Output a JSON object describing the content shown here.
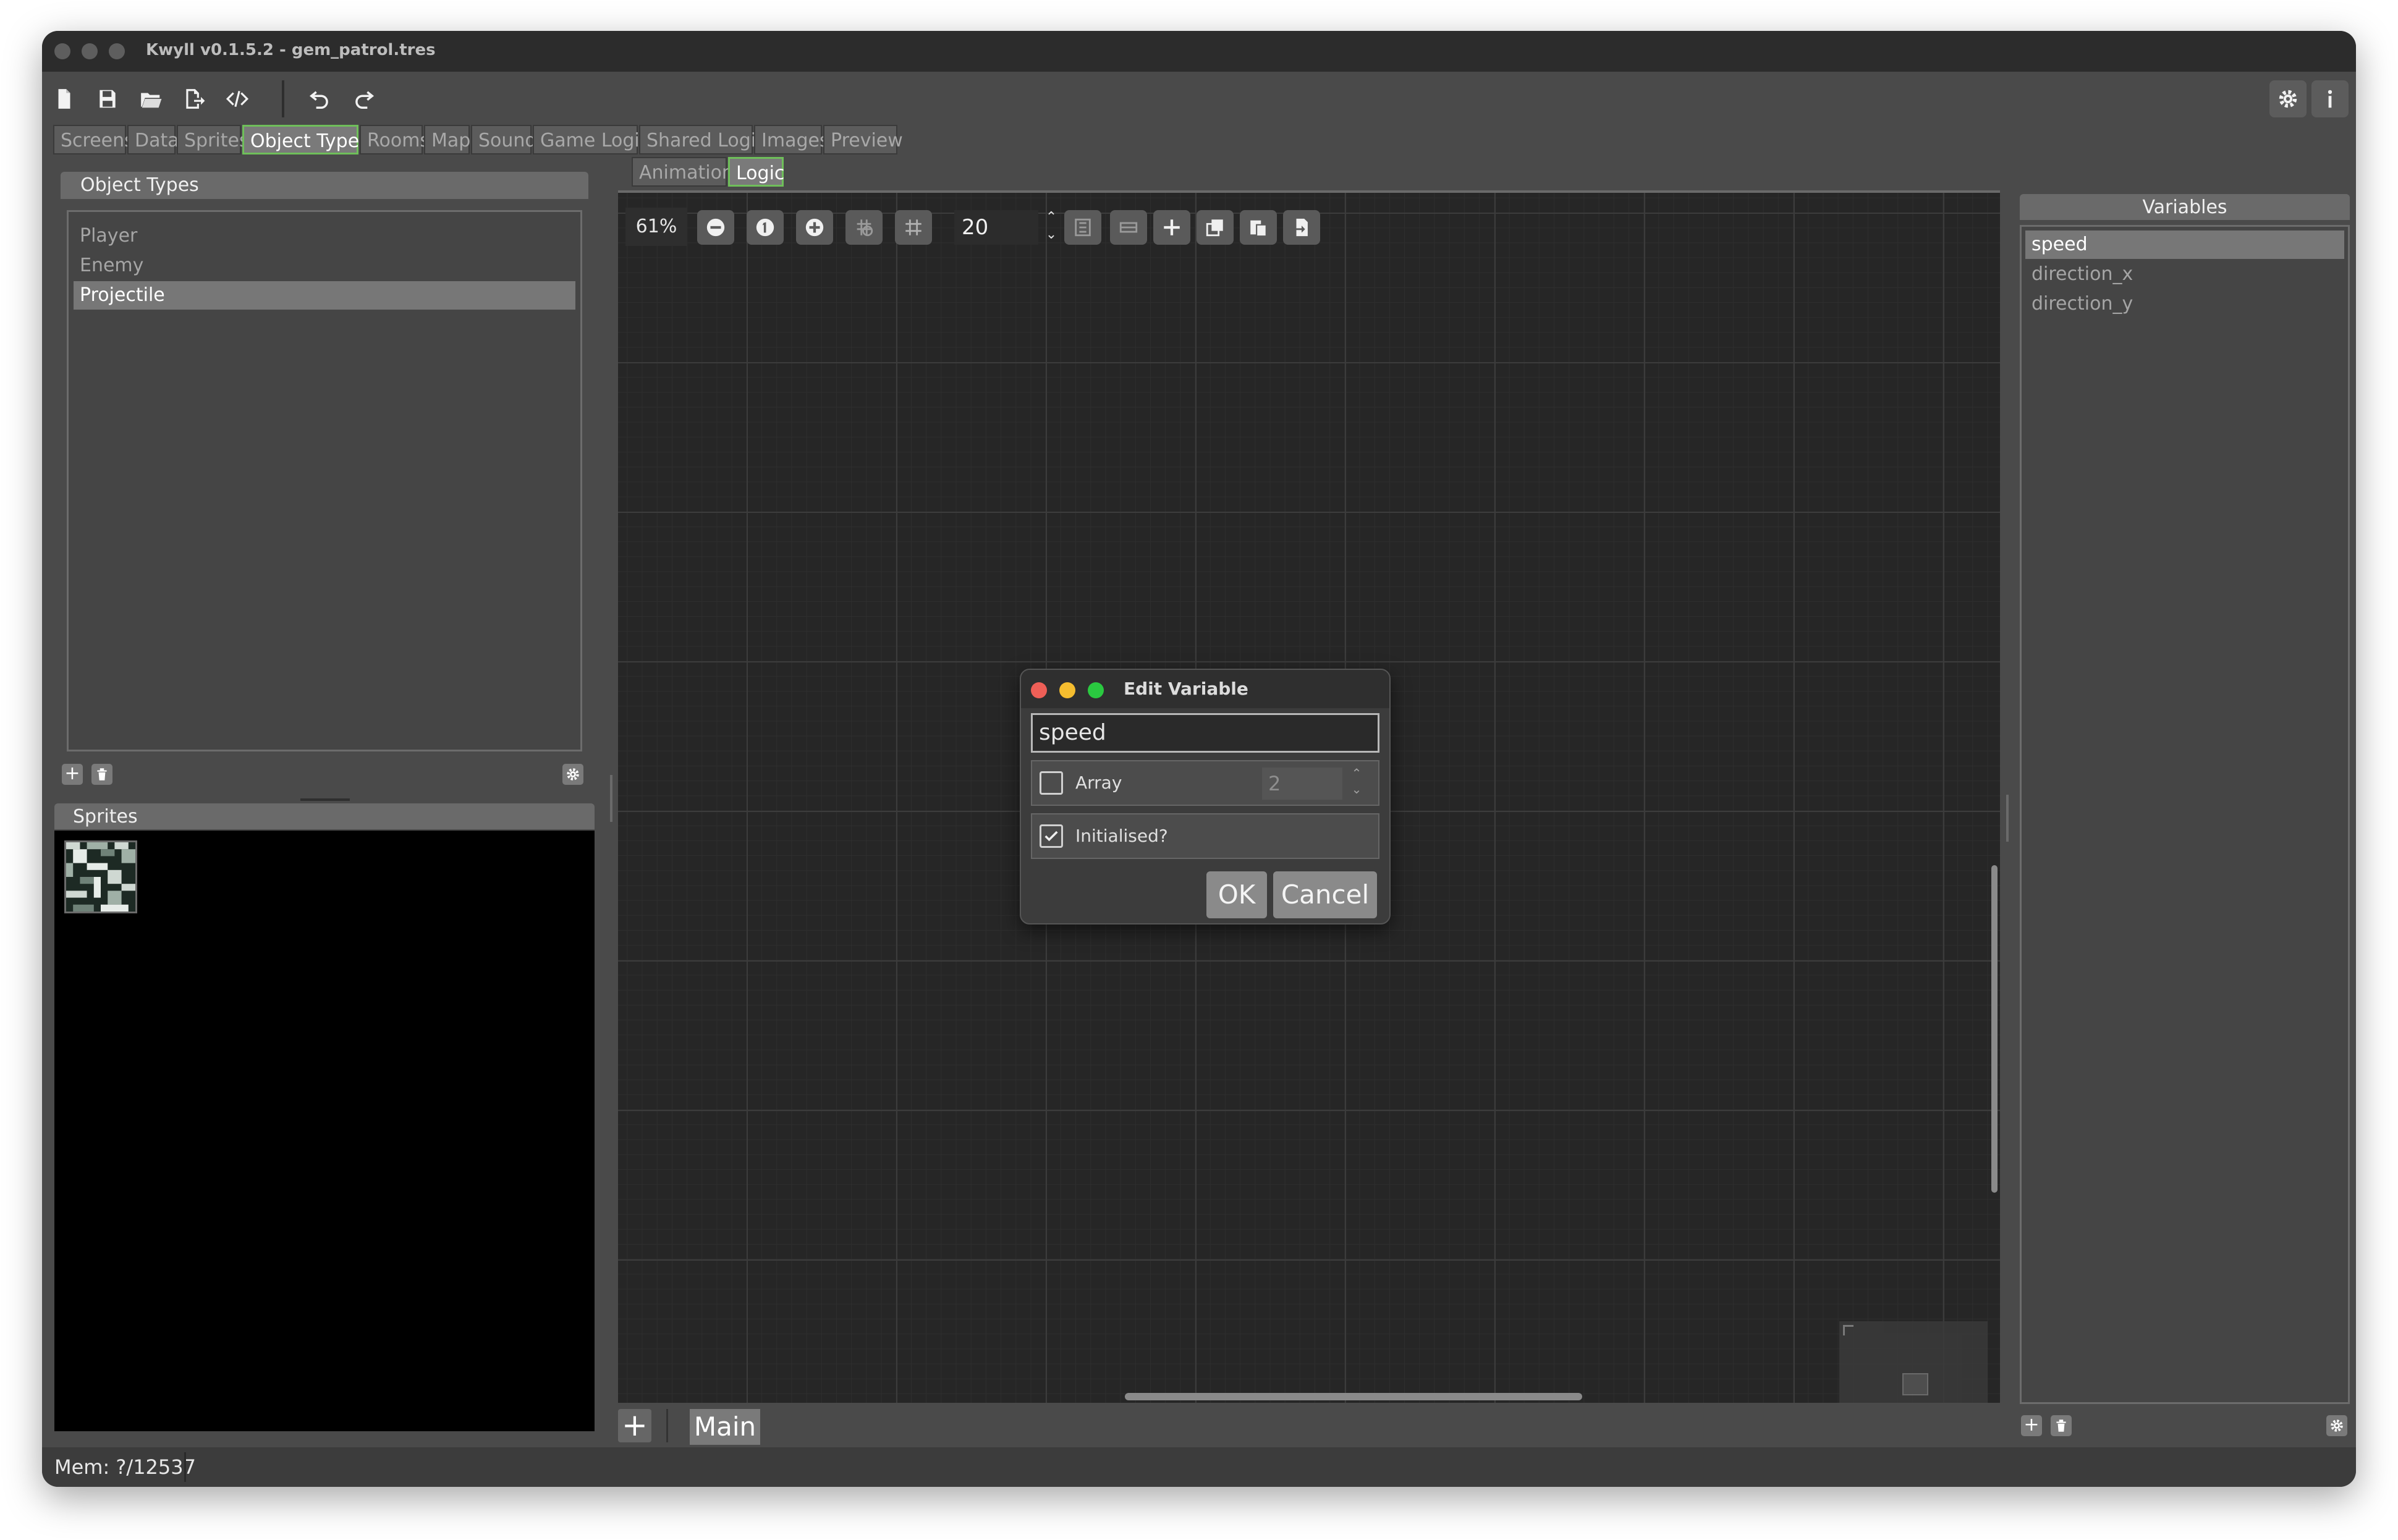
{
  "window": {
    "title": "Kwyll v0.1.5.2 - gem_patrol.tres"
  },
  "main_tabs": [
    {
      "label": "Screens"
    },
    {
      "label": "Data"
    },
    {
      "label": "Sprites"
    },
    {
      "label": "Object Types",
      "active": true
    },
    {
      "label": "Rooms"
    },
    {
      "label": "Map"
    },
    {
      "label": "Sound"
    },
    {
      "label": "Game Logic"
    },
    {
      "label": "Shared Logic"
    },
    {
      "label": "Images"
    },
    {
      "label": "Preview"
    }
  ],
  "object_types": {
    "header": "Object Types",
    "items": [
      {
        "label": "Player"
      },
      {
        "label": "Enemy"
      },
      {
        "label": "Projectile",
        "selected": true
      }
    ]
  },
  "sprites": {
    "header": "Sprites"
  },
  "editor_tabs": [
    {
      "label": "Animation"
    },
    {
      "label": "Logic",
      "active": true
    }
  ],
  "canvas_toolbar": {
    "zoom": "61%",
    "grid_size": "20"
  },
  "variables": {
    "header": "Variables",
    "items": [
      {
        "label": "speed",
        "selected": true
      },
      {
        "label": "direction_x"
      },
      {
        "label": "direction_y"
      }
    ]
  },
  "dialog": {
    "title": "Edit Variable",
    "name_value": "speed",
    "array_label": "Array",
    "array_checked": false,
    "array_size": "2",
    "initialised_label": "Initialised?",
    "initialised_checked": true,
    "ok_label": "OK",
    "cancel_label": "Cancel"
  },
  "bottom": {
    "add_label": "+",
    "main_tab": "Main"
  },
  "status": {
    "memory": "Mem: ?/12537"
  },
  "colors": {
    "accent_green": "#6fbf5a",
    "close_red": "#ee5f57",
    "minimize_yellow": "#f5bd2f",
    "maximize_green": "#2ac940"
  }
}
